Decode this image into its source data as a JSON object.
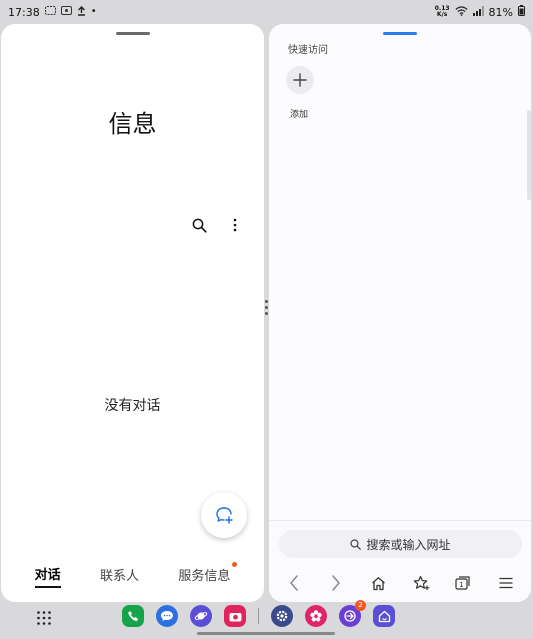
{
  "status_bar": {
    "time": "17:38",
    "net_speed_value": "0.13",
    "net_speed_unit": "K/s",
    "battery": "81%"
  },
  "messages": {
    "title": "信息",
    "empty_text": "没有对话",
    "tabs": [
      {
        "label": "对话",
        "active": true
      },
      {
        "label": "联系人",
        "active": false
      },
      {
        "label": "服务信息",
        "active": false,
        "dot": true
      }
    ]
  },
  "browser": {
    "quick_access_label": "快速访问",
    "add_label": "添加",
    "search_placeholder": "搜索或输入网址",
    "tab_count": "1"
  },
  "taskbar": {
    "apps": [
      {
        "name": "phone",
        "color": "#17a34a"
      },
      {
        "name": "messages",
        "color": "#2f6fe0"
      },
      {
        "name": "internet",
        "color": "#5b4fd6"
      },
      {
        "name": "camera",
        "color": "#e0245e"
      },
      {
        "name": "settings",
        "color": "#3a4a8a"
      },
      {
        "name": "blossom",
        "color": "#e0246a"
      },
      {
        "name": "share",
        "color": "#6a3fd6",
        "badge": "2"
      },
      {
        "name": "home",
        "color": "#5b4fd6"
      }
    ]
  },
  "colors": {
    "accent": "#2b7de9",
    "badge": "#f05a28"
  }
}
